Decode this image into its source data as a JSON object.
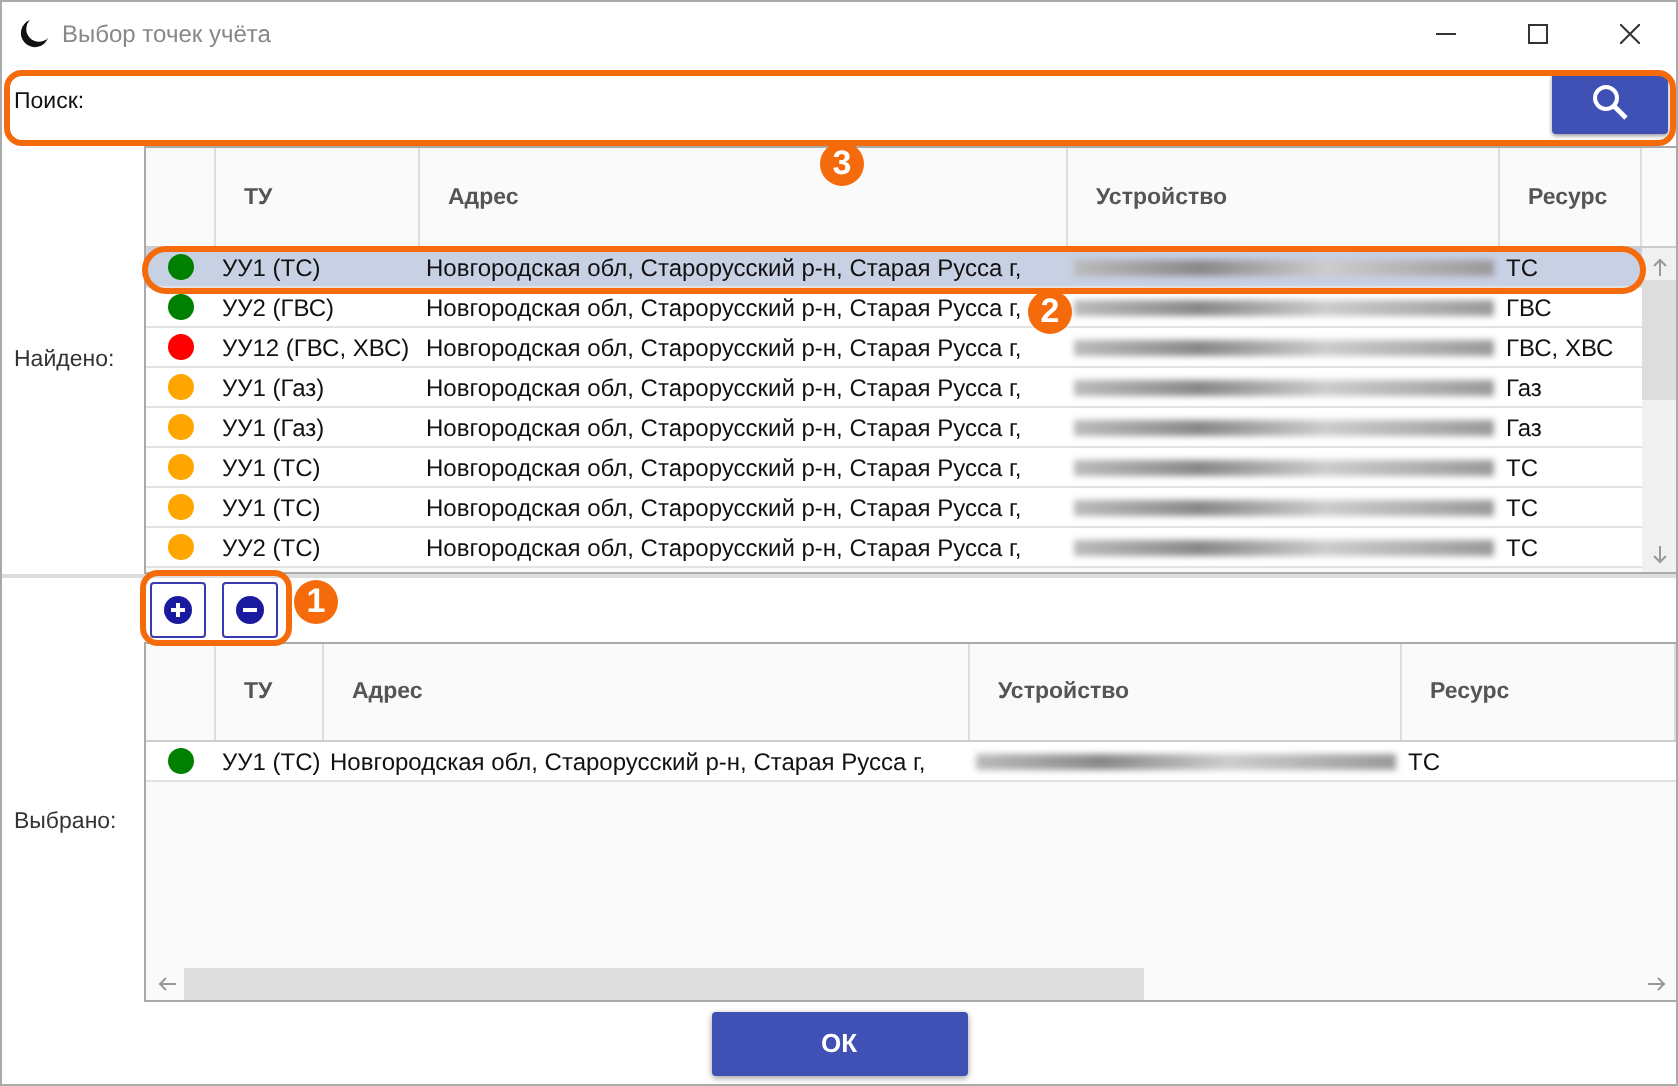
{
  "window": {
    "title": "Выбор точек учёта"
  },
  "search": {
    "label": "Поиск:"
  },
  "found": {
    "label": "Найдено:",
    "columns": [
      "ТУ",
      "Адрес",
      "Устройство",
      "Ресурс"
    ],
    "rows": [
      {
        "color": "#008000",
        "tu": "УУ1 (ТС)",
        "address": "Новгородская обл, Старорусский р-н, Старая Русса г,",
        "resource": "ТС",
        "selected": true
      },
      {
        "color": "#008000",
        "tu": "УУ2 (ГВС)",
        "address": "Новгородская обл, Старорусский р-н, Старая Русса г,",
        "resource": "ГВС",
        "selected": false
      },
      {
        "color": "#ff0000",
        "tu": "УУ12 (ГВС, ХВС)",
        "address": "Новгородская обл, Старорусский р-н, Старая Русса г,",
        "resource": "ГВС, ХВС",
        "selected": false
      },
      {
        "color": "#ffa500",
        "tu": "УУ1 (Газ)",
        "address": "Новгородская обл, Старорусский р-н, Старая Русса г,",
        "resource": "Газ",
        "selected": false
      },
      {
        "color": "#ffa500",
        "tu": "УУ1 (Газ)",
        "address": "Новгородская обл, Старорусский р-н, Старая Русса г,",
        "resource": "Газ",
        "selected": false
      },
      {
        "color": "#ffa500",
        "tu": "УУ1 (ТС)",
        "address": "Новгородская обл, Старорусский р-н, Старая Русса г,",
        "resource": "ТС",
        "selected": false
      },
      {
        "color": "#ffa500",
        "tu": "УУ1 (ТС)",
        "address": "Новгородская обл, Старорусский р-н, Старая Русса г,",
        "resource": "ТС",
        "selected": false
      },
      {
        "color": "#ffa500",
        "tu": "УУ2 (ТС)",
        "address": "Новгородская обл, Старорусский р-н, Старая Русса г,",
        "resource": "ТС",
        "selected": false
      }
    ]
  },
  "chosen": {
    "label": "Выбрано:",
    "columns": [
      "ТУ",
      "Адрес",
      "Устройство",
      "Ресурс"
    ],
    "rows": [
      {
        "color": "#008000",
        "tu": "УУ1 (ТС)",
        "address": "Новгородская обл, Старорусский р-н, Старая Русса г,",
        "resource": "ТС"
      }
    ]
  },
  "ok_button": "ОК",
  "annotations": [
    "1",
    "2",
    "3"
  ]
}
